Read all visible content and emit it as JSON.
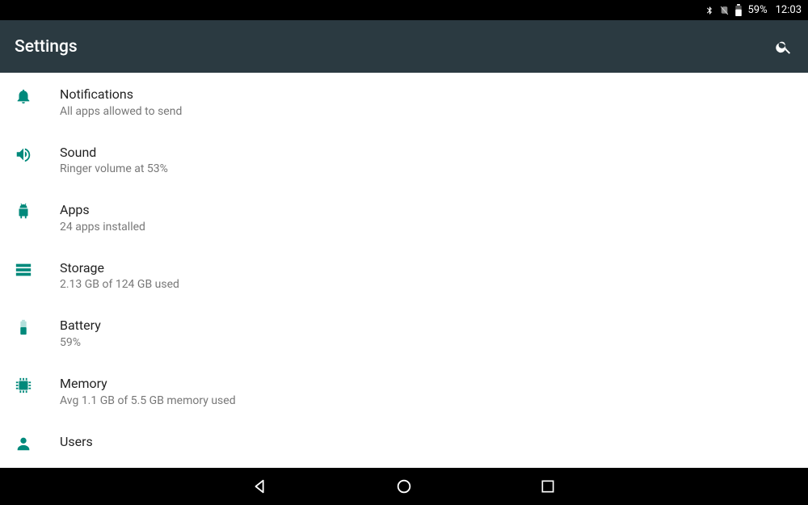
{
  "status": {
    "battery_text": "59%",
    "time": "12:03"
  },
  "appbar": {
    "title": "Settings"
  },
  "items": [
    {
      "icon": "bell",
      "title": "Notifications",
      "subtitle": "All apps allowed to send"
    },
    {
      "icon": "sound",
      "title": "Sound",
      "subtitle": "Ringer volume at 53%"
    },
    {
      "icon": "android",
      "title": "Apps",
      "subtitle": "24 apps installed"
    },
    {
      "icon": "storage",
      "title": "Storage",
      "subtitle": "2.13 GB of 124 GB used"
    },
    {
      "icon": "battery",
      "title": "Battery",
      "subtitle": "59%"
    },
    {
      "icon": "memory",
      "title": "Memory",
      "subtitle": "Avg 1.1 GB of 5.5 GB memory used"
    },
    {
      "icon": "user",
      "title": "Users",
      "subtitle": ""
    }
  ],
  "colors": {
    "accent": "#00897b",
    "appbar": "#2b3a41"
  }
}
